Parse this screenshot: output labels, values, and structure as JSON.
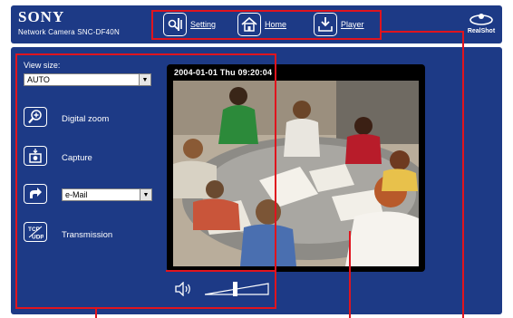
{
  "brand": {
    "logo": "SONY",
    "model": "Network Camera SNC-DF40N"
  },
  "menu": {
    "setting": "Setting",
    "home": "Home",
    "player": "Player"
  },
  "realshot": "RealShot",
  "sidebar": {
    "view_size_label": "View size:",
    "view_size_value": "AUTO",
    "zoom_label": "Digital zoom",
    "capture_label": "Capture",
    "trigger_value": "e-Mail",
    "transmission_label": "Transmission"
  },
  "video": {
    "timestamp": "2004-01-01 Thu 09:20:04"
  },
  "icons": {
    "setting": "setting-icon",
    "home": "home-icon",
    "player": "player-icon",
    "realshot": "realshot-icon",
    "zoom": "zoom-in-icon",
    "capture": "camera-icon",
    "trigger": "trigger-icon",
    "transmission": "tcp-udp-icon",
    "speaker": "speaker-icon"
  },
  "colors": {
    "panel": "#1d3a86",
    "callout": "#e0141e"
  }
}
